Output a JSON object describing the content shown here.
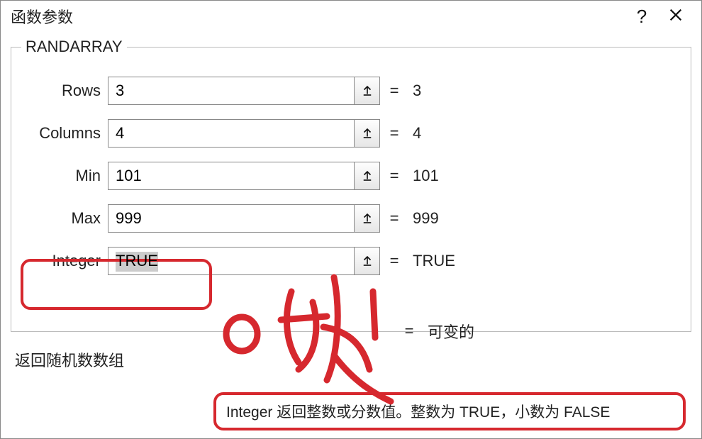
{
  "title": "函数参数",
  "group": "RANDARRAY",
  "params": [
    {
      "label": "Rows",
      "value": "3",
      "result": "3"
    },
    {
      "label": "Columns",
      "value": "4",
      "result": "4"
    },
    {
      "label": "Min",
      "value": "101",
      "result": "101"
    },
    {
      "label": "Max",
      "value": "999",
      "result": "999"
    },
    {
      "label": "Integer",
      "value": "TRUE",
      "result": "TRUE"
    }
  ],
  "equals": "=",
  "overall_result": "可变的",
  "description": "返回随机数数组",
  "hint": "Integer  返回整数或分数值。整数为 TRUE，小数为 FALSE",
  "help_symbol": "?"
}
